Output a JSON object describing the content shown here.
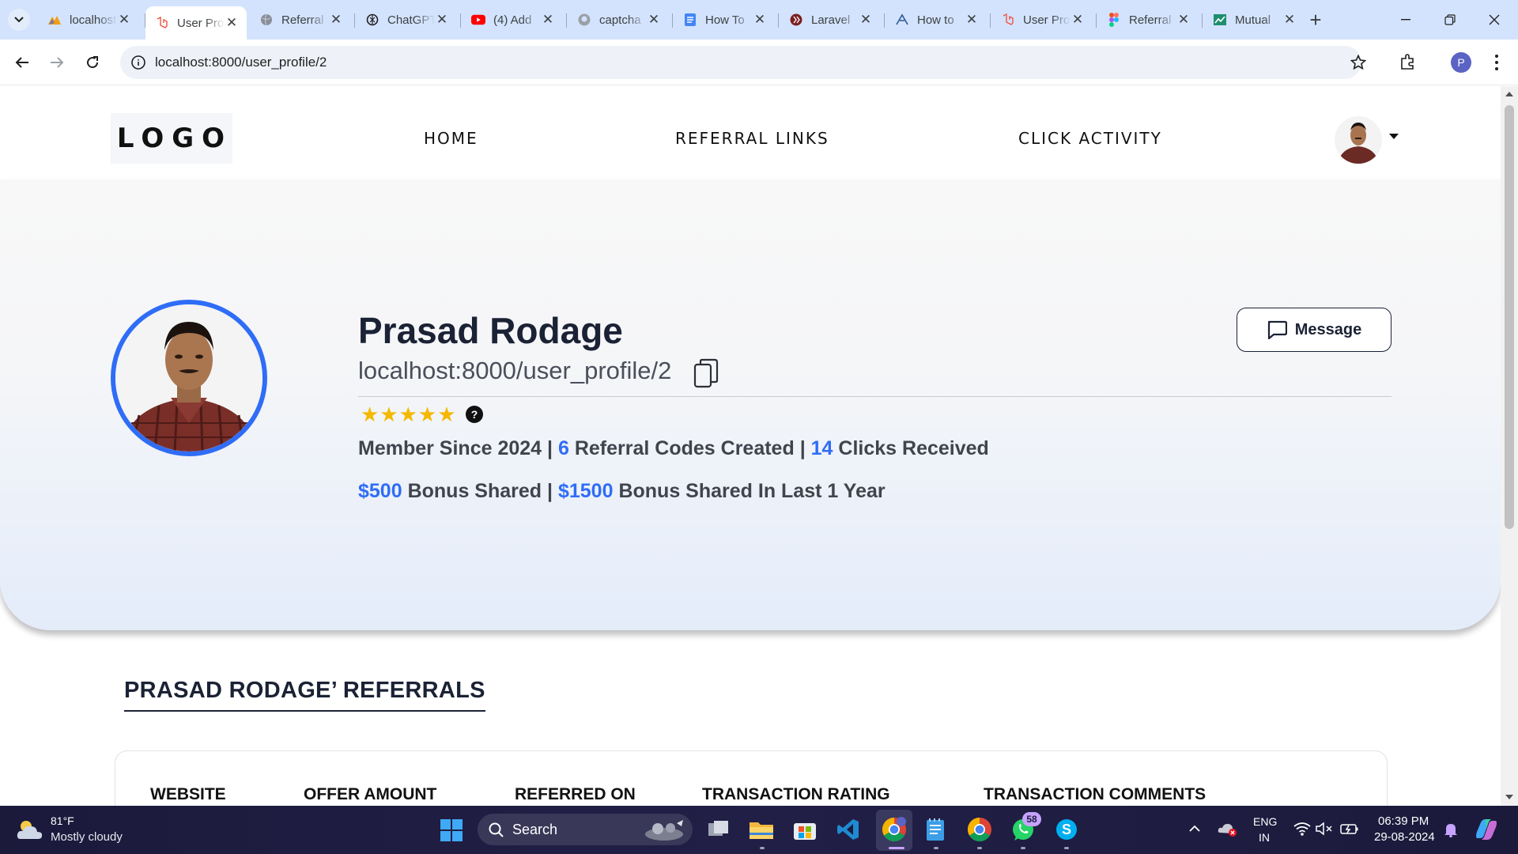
{
  "browser": {
    "tabs": [
      {
        "title": "localhost"
      },
      {
        "title": "User Profile"
      },
      {
        "title": "Referral"
      },
      {
        "title": "ChatGPT"
      },
      {
        "title": "(4) Add"
      },
      {
        "title": "captcha"
      },
      {
        "title": "How To"
      },
      {
        "title": "Laravel"
      },
      {
        "title": "How to"
      },
      {
        "title": "User Profile"
      },
      {
        "title": "Referral"
      },
      {
        "title": "Mutual"
      }
    ],
    "url": "localhost:8000/user_profile/2",
    "profile_initial": "P"
  },
  "site": {
    "logo": "LOGO",
    "nav": [
      "HOME",
      "REFERRAL LINKS",
      "CLICK ACTIVITY"
    ]
  },
  "profile": {
    "name": "Prasad Rodage",
    "url": "localhost:8000/user_profile/2",
    "rating": 5,
    "stars": "★★★★★",
    "help": "?",
    "member_since_label": "Member Since 2024",
    "sep": "|",
    "codes_count": "6",
    "codes_label": "Referral Codes Created",
    "clicks_count": "14",
    "clicks_label": "Clicks Received",
    "bonus_total": "$500",
    "bonus_total_label": "Bonus Shared",
    "bonus_year": "$1500",
    "bonus_year_label": "Bonus Shared In Last 1 Year",
    "message_label": "Message"
  },
  "referrals": {
    "title": "PRASAD RODAGE’ REFERRALS",
    "columns": [
      "WEBSITE",
      "OFFER AMOUNT",
      "REFERRED ON",
      "TRANSACTION RATING",
      "TRANSACTION COMMENTS"
    ]
  },
  "taskbar": {
    "weather_temp": "81°F",
    "weather_desc": "Mostly cloudy",
    "search": "Search",
    "whatsapp_badge": "58",
    "lang_line1": "ENG",
    "lang_line2": "IN",
    "time": "06:39 PM",
    "date": "29-08-2024"
  },
  "colors": {
    "accent": "#2f6df6",
    "star": "#f5b800",
    "heading": "#1b2235"
  }
}
